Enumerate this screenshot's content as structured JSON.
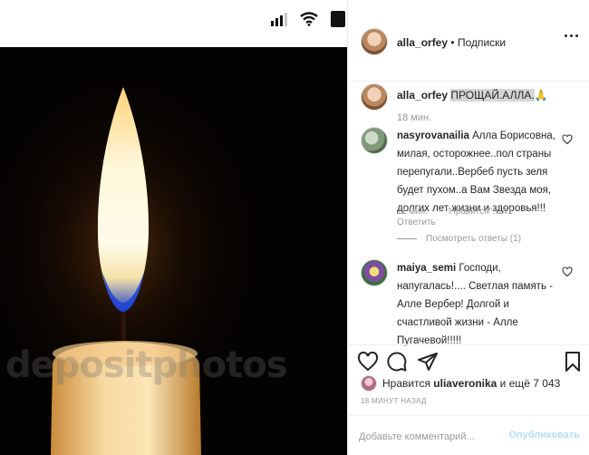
{
  "post": {
    "author": "alla_orfey",
    "follow_status": "Подписки",
    "header_separator": "•",
    "photo_watermark": "depositphotos"
  },
  "caption": {
    "author": "alla_orfey",
    "text": "ПРОЩАЙ.АЛЛА.",
    "emoji": "🙏",
    "time": "18 мин."
  },
  "comments": [
    {
      "author": "nasyrovanailia",
      "text": "Алла Борисовна, милая, осторожнее..пол страны перепугали..Вербеб пусть зеля будет пухом..а Вам Звезда моя, долгих лет жизни и здоровья!!!",
      "time": "11 мин.",
      "likes": "\"Нравится\": 141",
      "reply": "Ответить",
      "view_replies": "Посмотреть ответы (1)"
    },
    {
      "author": "maiya_semi",
      "text": "Господи, напугалась!.... Светлая память - Алле Вербер! Долгой и счастливой жизни - Алле Пугачевой!!!!!"
    }
  ],
  "likes": {
    "prefix": "Нравится",
    "user": "uliaveronika",
    "suffix": "и ещё 7 043"
  },
  "time_ago": "18 МИНУТ НАЗАД",
  "add_comment": {
    "placeholder": "Добавьте комментарий...",
    "publish_label": "Опубликовать"
  },
  "colors": {
    "link_disabled": "#b2dffc",
    "muted": "#999999"
  }
}
